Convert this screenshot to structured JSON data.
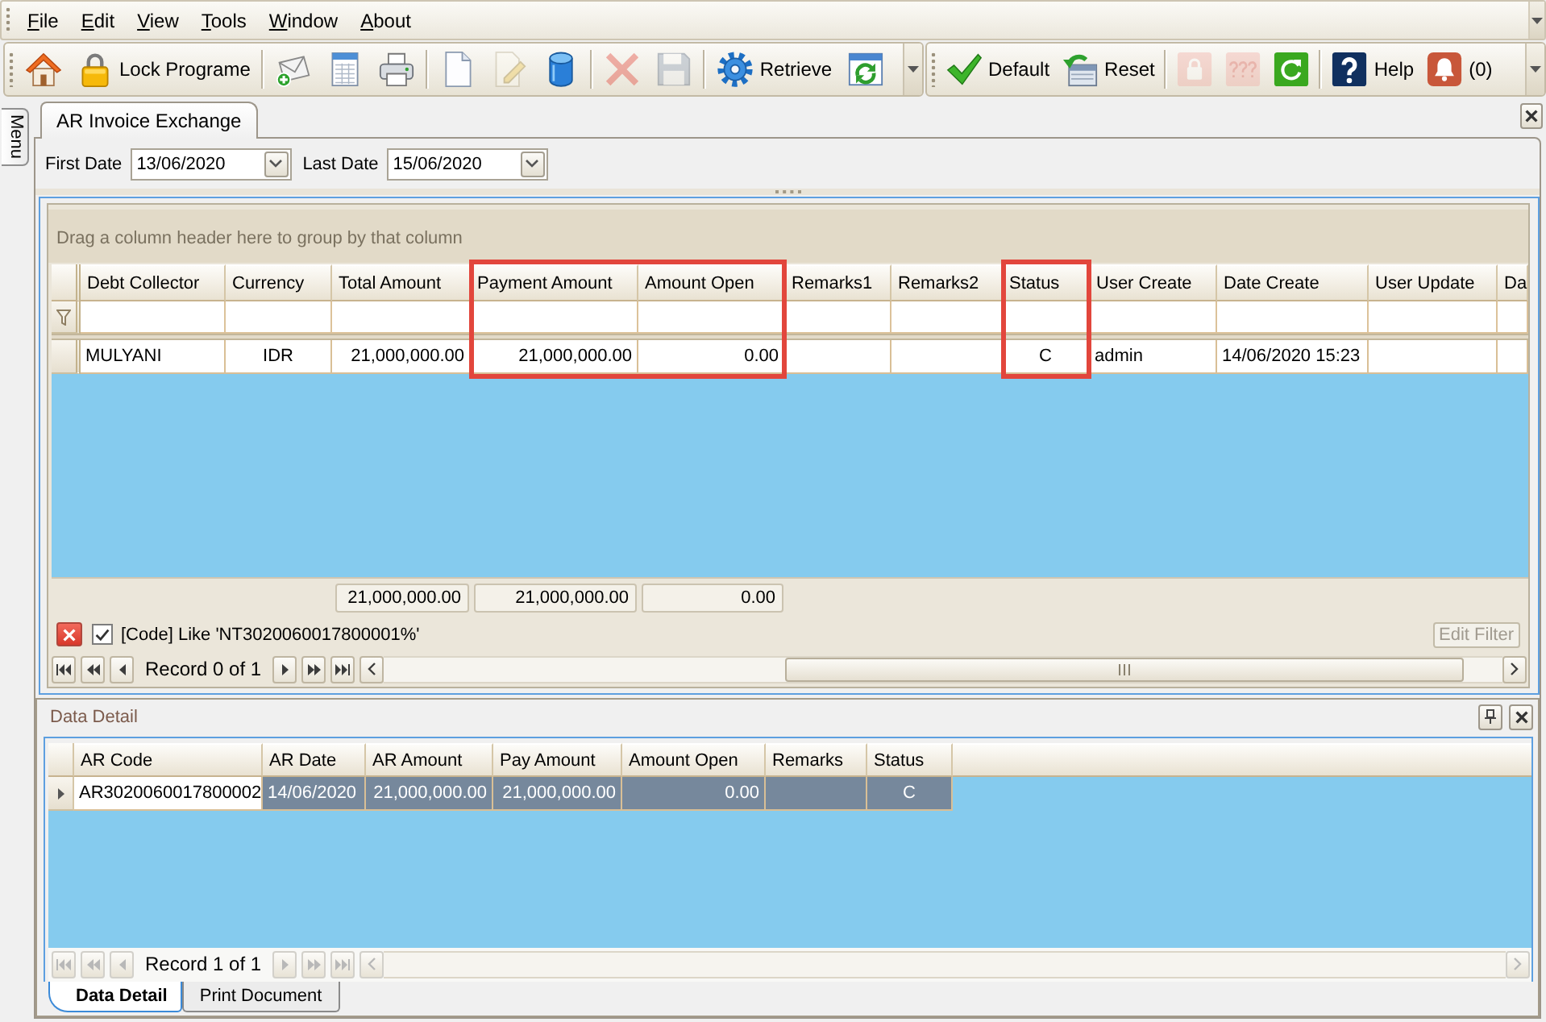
{
  "menu_bar": {
    "items": [
      "File",
      "Edit",
      "View",
      "Tools",
      "Window",
      "About"
    ]
  },
  "toolbars": [
    {
      "items": [
        {
          "kind": "button",
          "disabled": false
        },
        {
          "kind": "button",
          "label": "Lock Programe",
          "disabled": false
        },
        {
          "kind": "separator"
        },
        {
          "kind": "button",
          "disabled": false
        },
        {
          "kind": "button",
          "disabled": false
        },
        {
          "kind": "button",
          "disabled": false
        },
        {
          "kind": "separator"
        },
        {
          "kind": "button",
          "disabled": false
        },
        {
          "kind": "button",
          "disabled": true
        },
        {
          "kind": "button",
          "disabled": false
        },
        {
          "kind": "separator"
        },
        {
          "kind": "button",
          "disabled": true
        },
        {
          "kind": "button",
          "disabled": true
        },
        {
          "kind": "separator"
        },
        {
          "kind": "button",
          "label": "Retrieve",
          "disabled": false
        },
        {
          "kind": "button",
          "disabled": false
        }
      ]
    },
    {
      "items": [
        {
          "kind": "button",
          "label": "Default",
          "disabled": false
        },
        {
          "kind": "button",
          "label": "Reset",
          "disabled": false
        },
        {
          "kind": "separator"
        },
        {
          "kind": "button",
          "disabled": true
        },
        {
          "kind": "button",
          "disabled": true
        },
        {
          "kind": "button",
          "disabled": false
        },
        {
          "kind": "separator"
        },
        {
          "kind": "button",
          "label": "Help",
          "disabled": false
        },
        {
          "kind": "button",
          "label": "(0)",
          "disabled": false
        }
      ]
    }
  ],
  "side_panel": {
    "tab_label": "Menu"
  },
  "document_tabs": [
    {
      "label": "AR Invoice Exchange",
      "selected": true
    }
  ],
  "date_filter": {
    "first_date": {
      "label": "First Date",
      "value": "13/06/2020"
    },
    "last_date": {
      "label": "Last Date",
      "value": "15/06/2020"
    }
  },
  "invoice_grid": {
    "group_hint": "Drag a column header here to group by that column",
    "columns": [
      {
        "title": "Debt Collector",
        "kind": "text",
        "highlighted": false
      },
      {
        "title": "Currency",
        "kind": "code",
        "highlighted": false
      },
      {
        "title": "Total Amount",
        "kind": "amount",
        "highlighted": false,
        "total": "21,000,000.00"
      },
      {
        "title": "Payment Amount",
        "kind": "amount",
        "highlighted": true,
        "total": "21,000,000.00"
      },
      {
        "title": "Amount Open",
        "kind": "amount",
        "highlighted": true,
        "total": "0.00"
      },
      {
        "title": "Remarks1",
        "kind": "text",
        "highlighted": false
      },
      {
        "title": "Remarks2",
        "kind": "text",
        "highlighted": false
      },
      {
        "title": "Status",
        "kind": "code",
        "highlighted": true
      },
      {
        "title": "User Create",
        "kind": "text",
        "highlighted": false
      },
      {
        "title": "Date Create",
        "kind": "text",
        "highlighted": false
      },
      {
        "title": "User Update",
        "kind": "text",
        "highlighted": false
      },
      {
        "title": "Da",
        "kind": "text",
        "highlighted": false
      }
    ],
    "rows": [
      {
        "selected": false,
        "current": false,
        "cells": [
          "MULYANI",
          "IDR",
          "21,000,000.00",
          "21,000,000.00",
          "0.00",
          null,
          null,
          "C",
          "admin",
          "14/06/2020 15:23",
          null,
          null
        ]
      }
    ],
    "filter": {
      "active": true,
      "expression": "[Code] Like 'NT3020060017800001%'",
      "edit_button": {
        "label": "Edit Filter",
        "disabled": true
      }
    },
    "navigator": {
      "record_text": "Record 0 of 1",
      "disabled": false
    }
  },
  "detail_panel": {
    "title": "Data Detail",
    "grid": {
      "columns": [
        {
          "title": "AR Code",
          "kind": "text"
        },
        {
          "title": "AR Date",
          "kind": "text"
        },
        {
          "title": "AR Amount",
          "kind": "amount"
        },
        {
          "title": "Pay Amount",
          "kind": "amount"
        },
        {
          "title": "Amount Open",
          "kind": "amount"
        },
        {
          "title": "Remarks",
          "kind": "text"
        },
        {
          "title": "Status",
          "kind": "code"
        }
      ],
      "rows": [
        {
          "selected": true,
          "current": true,
          "cells": [
            {
              "text": "AR3020060017800002",
              "focused": true
            },
            {
              "text": "14/06/2020",
              "focused": false
            },
            {
              "text": "21,000,000.00",
              "focused": false
            },
            {
              "text": "21,000,000.00",
              "focused": false
            },
            {
              "text": "0.00",
              "focused": false
            },
            {
              "focused": false
            },
            {
              "text": "C",
              "focused": false
            }
          ]
        }
      ],
      "navigator": {
        "record_text": "Record 1 of 1",
        "disabled": true
      }
    },
    "tabs": [
      {
        "label": "Data Detail",
        "selected": true
      },
      {
        "label": "Print Document",
        "selected": false
      }
    ]
  }
}
